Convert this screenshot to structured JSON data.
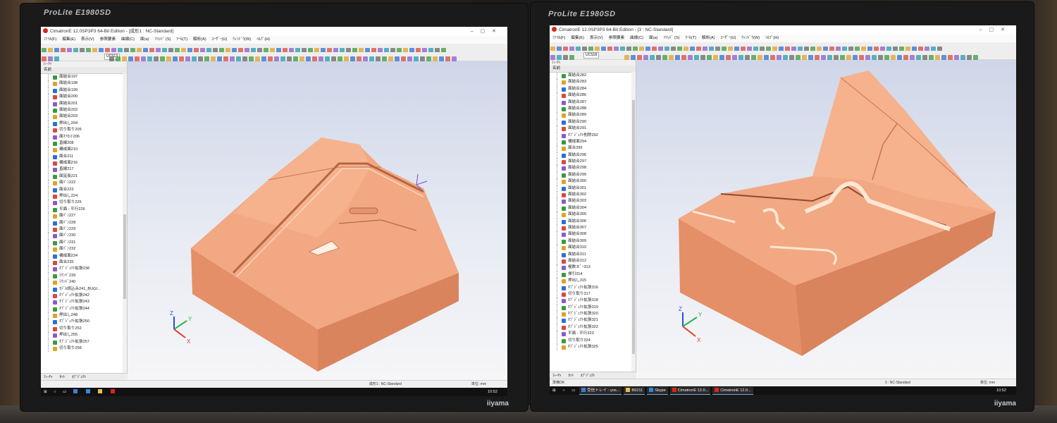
{
  "left_monitor": {
    "brand": "ProLite E1980SD",
    "maker": "iiyama",
    "window_title": "CimatronE 12.0SP3P3 64-Bit Edition - [成形1 : NC-Standard]",
    "menu": [
      "ﾌｧｲﾙ(F)",
      "編集(E)",
      "表示(V)",
      "参照要素",
      "曲線(C)",
      "面(a)",
      "ｿﾘｯﾄﾞ (S)",
      "ﾂｰﾙ(T)",
      "解析(A)",
      "ﾕｰｻﾞｰ(U)",
      "ｳｨﾝﾄﾞｳ(W)",
      "ﾍﾙﾌﾟ(H)"
    ],
    "ucs": "UCS13",
    "tree_title": "ﾌｨｰﾁｬ",
    "tree_header": "名前",
    "tree_items": [
      "面結合197",
      "面結合198",
      "面結合199",
      "面結合200",
      "面結合201",
      "面結合202",
      "面結合203",
      "押出し204",
      "切り取り205",
      "面ｵﾌｾｯﾄ206",
      "直線208",
      "構成面210",
      "面合211",
      "構成面216",
      "直線217",
      "面延長221",
      "面ﾊﾟﾝ222",
      "面合223",
      "押出し224",
      "切り取り225",
      "平面 - 平行226",
      "面ﾊﾟﾝ227",
      "面ﾊﾟﾝ228",
      "面ﾊﾟﾝ229",
      "面ﾊﾟﾝ230",
      "面ﾊﾟﾝ231",
      "面ﾊﾟﾝ232",
      "構成面234",
      "面合235",
      "ｵﾌﾞｼﾞｪｸﾄ拡張238",
      "ﾗｳﾝﾄﾞ239",
      "ﾗｳﾝﾄﾞ240",
      "ﾓﾃﾞﾙ読込み241_BUGI...",
      "ｵﾌﾞｼﾞｪｸﾄ拡張242",
      "ｵﾌﾞｼﾞｪｸﾄ拡張243",
      "ｵﾌﾞｼﾞｪｸﾄ拡張244",
      "押出し248",
      "ｵﾌﾞｼﾞｪｸﾄ拡張250",
      "切り取り252",
      "押出し255",
      "ｵﾌﾞｼﾞｪｸﾄ拡張257",
      "切り取り258"
    ],
    "tree_tabs": [
      "ﾌｨｰﾁｬ",
      "ｾｯﾄ",
      "ｵﾌﾞｼﾞｪｸﾄ"
    ],
    "status_doc": "成形1 : NC-Standard",
    "status_unit": "単位: mm",
    "clock": "10:52"
  },
  "right_monitor": {
    "brand": "ProLite E1980SD",
    "maker": "iiyama",
    "window_title": "CimatronE 12.0SP3P3 64-Bit Edition - [3 : NC-Standard]",
    "menu": [
      "ﾌｧｲﾙ(F)",
      "編集(E)",
      "表示(V)",
      "参照要素",
      "曲線(C)",
      "面(a)",
      "ｿﾘｯﾄﾞ (S)",
      "ﾂｰﾙ(T)",
      "解析(A)",
      "ﾕｰｻﾞｰ(U)",
      "ｳｨﾝﾄﾞｳ(W)",
      "ﾍﾙﾌﾟ(H)"
    ],
    "ucs": "UCS18",
    "tree_title": "ﾌｨｰﾁｬ",
    "tree_header": "名前",
    "tree_items": [
      "面結合282",
      "面結合283",
      "面結合284",
      "面結合286",
      "面結合287",
      "面結合288",
      "面結合289",
      "面結合290",
      "面結合291",
      "ｵﾌﾞｼﾞｪｸﾄ削除292",
      "構成面294",
      "面合295",
      "面結合296",
      "面結合297",
      "面結合298",
      "面結合299",
      "面結合300",
      "面結合301",
      "面結合302",
      "面結合303",
      "面結合304",
      "面結合305",
      "面結合306",
      "面結合307",
      "面結合308",
      "面結合309",
      "面結合310",
      "面結合311",
      "面結合312",
      "複数ｺﾋﾟｰ313",
      "掃引314",
      "押出し315",
      "ｵﾌﾞｼﾞｪｸﾄ拡張316",
      "切り取り317",
      "ｵﾌﾞｼﾞｪｸﾄ拡張318",
      "ｵﾌﾞｼﾞｪｸﾄ拡張319",
      "ｵﾌﾞｼﾞｪｸﾄ拡張320",
      "ｵﾌﾞｼﾞｪｸﾄ拡張321",
      "ｵﾌﾞｼﾞｪｸﾄ拡張322",
      "平面 - 平行323",
      "切り取り324",
      "ｵﾌﾞｼﾞｪｸﾄ拡張325"
    ],
    "tree_tabs": [
      "ﾌｨｰﾁｬ",
      "ｾｯﾄ",
      "ｵﾌﾞｼﾞｪｸﾄ"
    ],
    "status_left": "準備OK",
    "status_doc": "3 : NC-Standard",
    "status_unit": "単位: mm",
    "taskbar_items": [
      "受信トレイ - yos...",
      "B6211",
      "Skype",
      "CimatronE 12.0...",
      "CimatronE 12.0..."
    ],
    "clock": "10:52"
  },
  "colors": {
    "part": "#f0a37c",
    "part_dark": "#d9845d",
    "part_shadow": "#c46f4b",
    "viewport_top": "#cfd6e8"
  },
  "icons": [
    "windows-start-icon",
    "search-icon",
    "task-view-icon",
    "app-logo-icon",
    "axis-triad-icon"
  ]
}
